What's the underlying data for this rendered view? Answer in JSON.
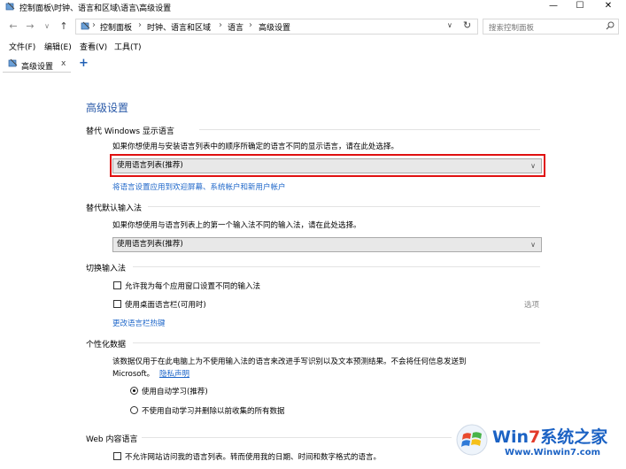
{
  "window": {
    "title": "控制面板\\时钟、语言和区域\\语言\\高级设置",
    "minimize": "—",
    "maximize": "☐",
    "close": "✕"
  },
  "nav": {
    "back": "←",
    "forward": "→",
    "dropdown": "∨",
    "up": "↑"
  },
  "address": {
    "crumbs": [
      "控制面板",
      "时钟、语言和区域",
      "语言",
      "高级设置"
    ],
    "separator": "›",
    "dropdown": "∨",
    "refresh": "↻"
  },
  "search": {
    "placeholder": "搜索控制面板"
  },
  "menu": {
    "items": [
      "文件(F)",
      "编辑(E)",
      "查看(V)",
      "工具(T)"
    ]
  },
  "tab": {
    "label": "高级设置",
    "close": "x",
    "add": "+"
  },
  "content": {
    "title": "高级设置",
    "display_language": {
      "heading": "替代 Windows 显示语言",
      "description": "如果你想使用与安装语言列表中的顺序所确定的语言不同的显示语言，请在此处选择。",
      "select_value": "使用语言列表(推荐)",
      "link": "将语言设置应用到欢迎屏幕、系统帐户和新用户帐户"
    },
    "input_method": {
      "heading": "替代默认输入法",
      "description": "如果你想使用与语言列表上的第一个输入法不同的输入法，请在此处选择。",
      "select_value": "使用语言列表(推荐)"
    },
    "switch_input": {
      "heading": "切换输入法",
      "checkbox1": "允许我为每个应用窗口设置不同的输入法",
      "checkbox2": "使用桌面语言栏(可用时)",
      "options": "选项",
      "link": "更改语言栏热键"
    },
    "personalization": {
      "heading": "个性化数据",
      "description_line1": "该数据仅用于在此电脑上为不使用输入法的语言来改进手写识别以及文本预测结果。不会将任何信息发送到",
      "description_line2": "Microsoft。",
      "privacy_link": "隐私声明",
      "radio1": "使用自动学习(推荐)",
      "radio2": "不使用自动学习并删除以前收集的所有数据"
    },
    "web_language": {
      "heading": "Web 内容语言",
      "checkbox": "不允许网站访问我的语言列表。转而使用我的日期、时间和数字格式的语言。"
    }
  },
  "watermark": {
    "brand_win": "Win",
    "brand_7": "7",
    "brand_rest": "系统之家",
    "url": "Www.Winwin7.com"
  },
  "colors": {
    "accent": "#2a5aa8",
    "link": "#1d66c9",
    "highlight_border": "#e01010",
    "watermark_blue": "#1b62c4",
    "watermark_red": "#e23a2a"
  }
}
